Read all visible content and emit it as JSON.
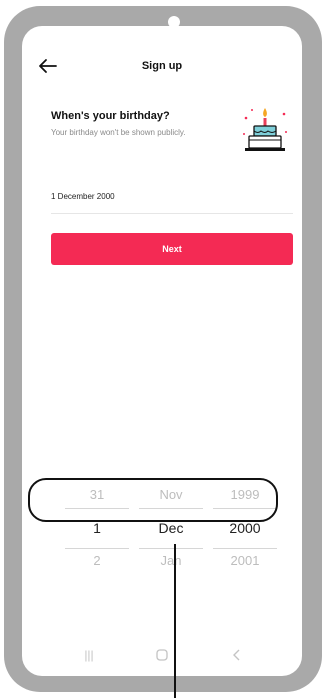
{
  "header": {
    "title": "Sign up",
    "back_icon": "arrow-left-icon"
  },
  "birthday": {
    "question": "When's your birthday?",
    "hint": "Your birthday won't be shown publicly.",
    "icon": "birthday-cake-icon"
  },
  "date_field": {
    "value": "1 December 2000"
  },
  "next_button": {
    "label": "Next",
    "color": "#f42a54"
  },
  "picker": {
    "day": {
      "prev": "31",
      "current": "1",
      "next": "2"
    },
    "month": {
      "prev": "Nov",
      "current": "Dec",
      "next": "Jan"
    },
    "year": {
      "prev": "1999",
      "current": "2000",
      "next": "2001"
    }
  },
  "nav": {
    "recent_icon": "recent-apps-icon",
    "home_icon": "home-icon",
    "back_icon": "back-chevron-icon"
  }
}
